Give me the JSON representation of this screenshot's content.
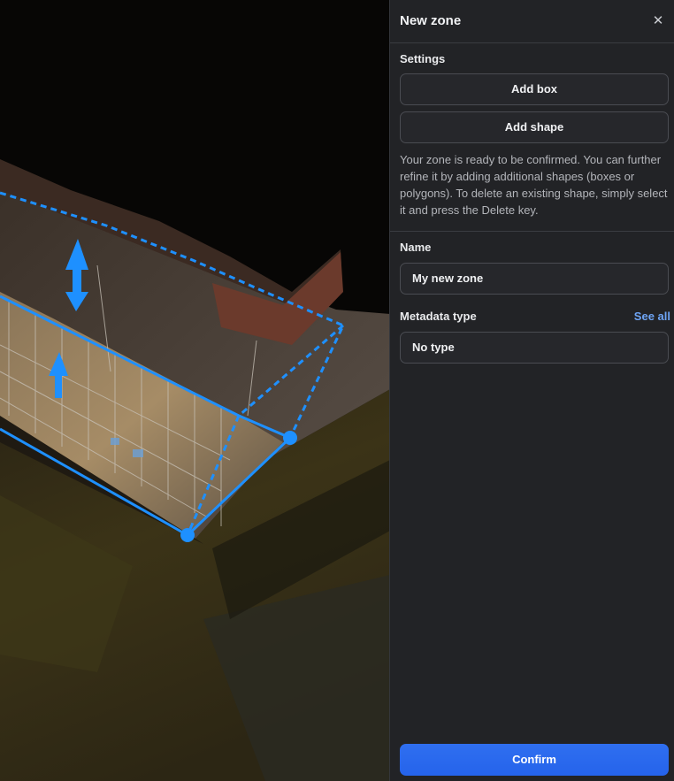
{
  "panel": {
    "title": "New zone",
    "close_icon": "close-icon",
    "settings": {
      "heading": "Settings",
      "add_box_label": "Add box",
      "add_shape_label": "Add shape",
      "help_text": "Your zone is ready to be confirmed. You can further refine it by adding additional shapes (boxes or polygons). To delete an existing shape, simply select it and press the Delete key."
    },
    "name": {
      "label": "Name",
      "value": "My new zone"
    },
    "metadata": {
      "label": "Metadata type",
      "see_all_label": "See all",
      "value": "No type"
    },
    "confirm_label": "Confirm"
  },
  "colors": {
    "accent": "#2563eb",
    "link": "#6ea4f4",
    "zone_outline": "#1e90ff",
    "panel_bg": "#222326"
  }
}
